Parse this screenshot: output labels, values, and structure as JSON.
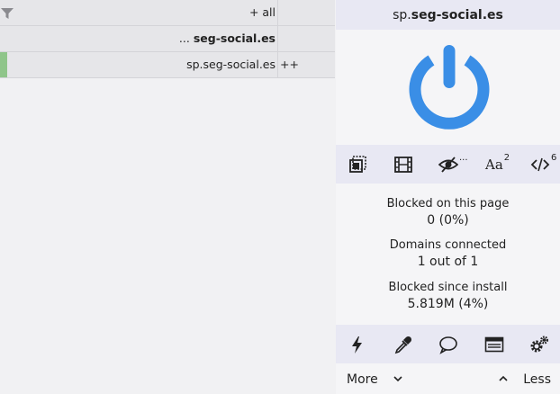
{
  "left": {
    "rows": [
      {
        "text": "+ all",
        "bold": false
      },
      {
        "prefix": "... ",
        "text": "seg-social.es",
        "bold": true
      },
      {
        "text": "sp.seg-social.es",
        "extra": "++"
      }
    ]
  },
  "popup": {
    "hostname_sub": "sp.",
    "hostname_main": "seg-social.es",
    "tools": {
      "cosmetic_sup": "...",
      "fonts_sup": "2",
      "scripts_sup": "6"
    },
    "stats": {
      "blocked_page_label": "Blocked on this page",
      "blocked_page_value": "0 (0%)",
      "domains_label": "Domains connected",
      "domains_value": "1 out of 1",
      "blocked_install_label": "Blocked since install",
      "blocked_install_value": "5.819M (4%)"
    },
    "more_label": "More",
    "less_label": "Less"
  },
  "colors": {
    "accent": "#3a8ee6",
    "panel": "#e8e8f3",
    "green": "#8fc58a"
  }
}
